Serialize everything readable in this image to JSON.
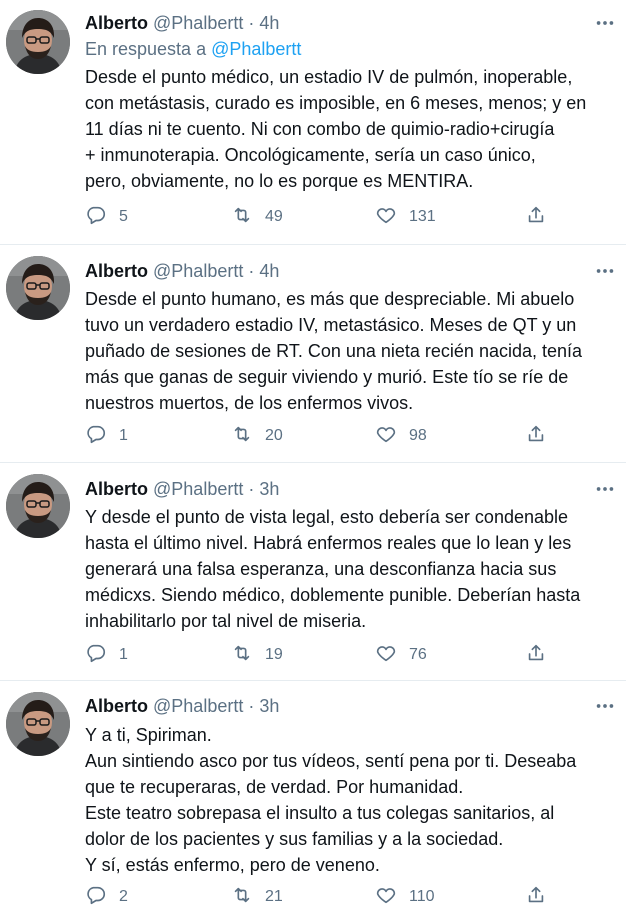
{
  "tweets": [
    {
      "name": "Alberto",
      "handle": "@Phalbertt",
      "sep": "·",
      "time": "4h",
      "reply_prefix": "En respuesta a",
      "reply_handle": "@Phalbertt",
      "lines": [
        "Desde el punto médico, un estadio IV de pulmón, inoperable,",
        "con metástasis, curado es imposible, en 6 meses, menos; y en",
        "11 días ni te cuento. Ni con combo de quimio-radio+cirugía",
        "+ inmunoterapia. Oncológicamente, sería un caso único,",
        "pero, obviamente, no lo es porque es MENTIRA."
      ],
      "replies": "5",
      "retweets": "49",
      "likes": "131"
    },
    {
      "name": "Alberto",
      "handle": "@Phalbertt",
      "sep": "·",
      "time": "4h",
      "lines": [
        "Desde el punto humano, es más que despreciable. Mi abuelo",
        "tuvo un verdadero estadio IV, metastásico. Meses de QT y un",
        "puñado de sesiones de RT. Con una nieta recién nacida, tenía",
        "más que ganas de seguir viviendo y murió. Este tío se ríe de",
        "nuestros muertos, de los enfermos vivos."
      ],
      "replies": "1",
      "retweets": "20",
      "likes": "98"
    },
    {
      "name": "Alberto",
      "handle": "@Phalbertt",
      "sep": "·",
      "time": "3h",
      "lines": [
        "Y desde el punto de vista legal, esto debería ser condenable",
        "hasta el último nivel. Habrá enfermos reales que lo lean y les",
        "generará una falsa esperanza, una desconfianza hacia sus",
        "médicxs. Siendo médico, doblemente punible. Deberían hasta",
        "inhabilitarlo por tal nivel de miseria."
      ],
      "replies": "1",
      "retweets": "19",
      "likes": "76"
    },
    {
      "name": "Alberto",
      "handle": "@Phalbertt",
      "sep": "·",
      "time": "3h",
      "lines": [
        "Y a ti, Spiriman.",
        "Aun sintiendo asco por tus vídeos, sentí pena por ti. Deseaba",
        "que te recuperaras, de verdad. Por humanidad.",
        "Este teatro sobrepasa el insulto a tus colegas sanitarios, al",
        "dolor de los pacientes y sus familias y a la sociedad.",
        "Y sí, estás enfermo, pero de veneno."
      ],
      "replies": "2",
      "retweets": "21",
      "likes": "110"
    }
  ],
  "icons": {
    "reply": "reply-icon",
    "retweet": "retweet-icon",
    "like": "heart-icon",
    "share": "share-icon",
    "more": "more-icon"
  },
  "colors": {
    "text": "#0f1419",
    "secondary": "#5b7083",
    "link": "#1da1f2",
    "divider": "#e6ecf0"
  }
}
